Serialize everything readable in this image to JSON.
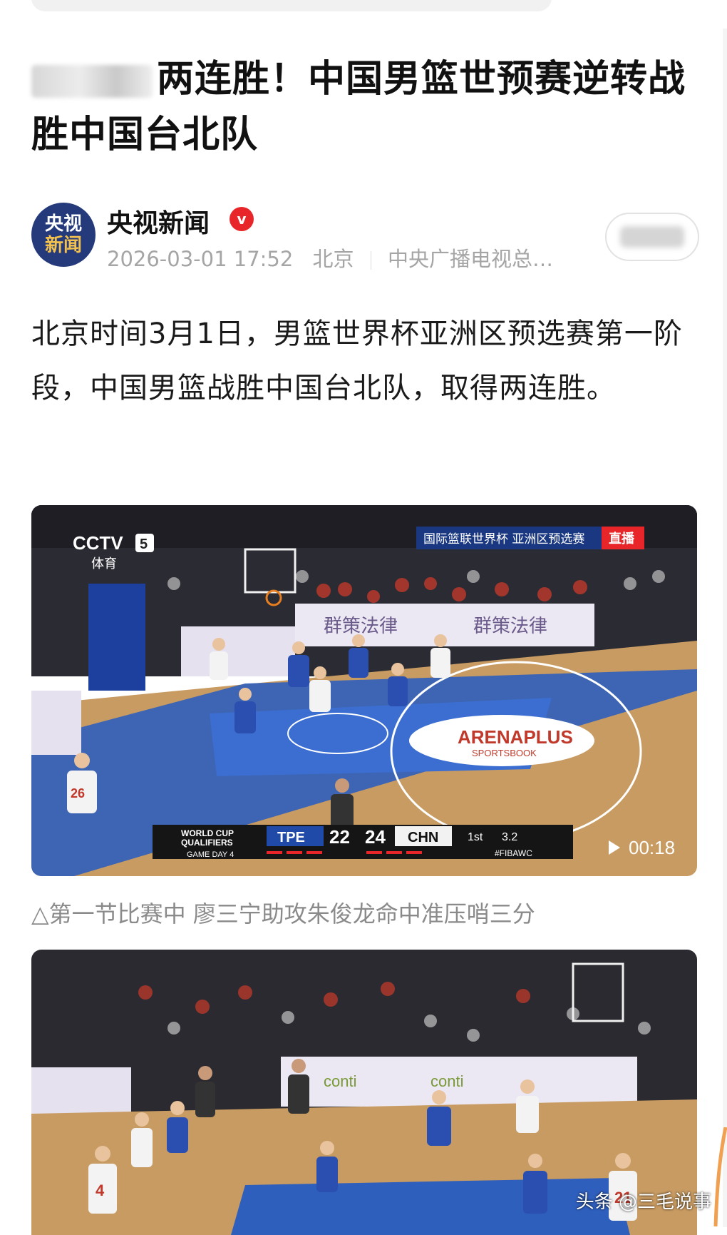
{
  "article": {
    "title_visible": "两连胜！中国男篮世预赛逆转战胜中国台北队",
    "author": {
      "avatar_text_line1": "央视",
      "avatar_text_line2": "新闻",
      "name": "央视新闻",
      "verified_mark": "v",
      "date": "2026-03-01 17:52",
      "location": "北京",
      "source": "中央广播电视总…"
    },
    "body": "北京时间3月1日，男篮世界杯亚洲区预选赛第一阶段，中国男篮战胜中国台北队，取得两连胜。",
    "video1": {
      "channel_logo": "CCTV",
      "channel_number": "5",
      "channel_name": "体育",
      "tournament_banner": "国际篮联世界杯 亚洲区预选赛",
      "live_badge": "直播",
      "sponsor_board": "群策法律",
      "court_logo": "ARENAPLUS",
      "court_logo_sub": "SPORTSBOOK",
      "scoreboard": {
        "event_line1": "WORLD CUP",
        "event_line2": "QUALIFIERS",
        "game_day": "GAME DAY 4",
        "team_left": "TPE",
        "score_left": "22",
        "score_right": "24",
        "team_right": "CHN",
        "period": "1st",
        "clock": "3.2",
        "hashtag": "#FIBAWC"
      },
      "duration": "00:18",
      "player_number": "26"
    },
    "caption": "△第一节比赛中 廖三宁助攻朱俊龙命中准压哨三分",
    "video2": {
      "sponsor_board": "conti",
      "player_number": "4",
      "player_number_2": "21"
    },
    "watermark": "头条 @三毛说事"
  },
  "colors": {
    "verified": "#e8262a",
    "avatar_bg": "#243a7a",
    "court_blue": "#2f5fbd",
    "court_wood": "#c89b62"
  }
}
